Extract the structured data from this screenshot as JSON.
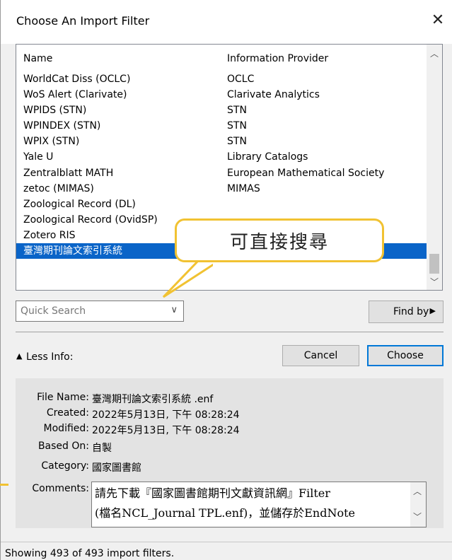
{
  "window": {
    "title": "Choose An Import Filter",
    "close_glyph": "✕"
  },
  "list": {
    "columns": [
      "Name",
      "Information Provider"
    ],
    "rows": [
      {
        "name": "WorldCat Diss (OCLC)",
        "provider": "OCLC"
      },
      {
        "name": "WoS Alert (Clarivate)",
        "provider": "Clarivate Analytics"
      },
      {
        "name": "WPIDS (STN)",
        "provider": "STN"
      },
      {
        "name": "WPINDEX (STN)",
        "provider": "STN"
      },
      {
        "name": "WPIX (STN)",
        "provider": "STN"
      },
      {
        "name": "Yale U",
        "provider": "Library Catalogs"
      },
      {
        "name": "Zentralblatt MATH",
        "provider": "European Mathematical Society"
      },
      {
        "name": "zetoc (MIMAS)",
        "provider": "MIMAS"
      },
      {
        "name": "Zoological Record (DL)",
        "provider": ""
      },
      {
        "name": "Zoological Record (OvidSP)",
        "provider": ""
      },
      {
        "name": "Zotero RIS",
        "provider": ""
      },
      {
        "name": "臺灣期刊論文索引系統",
        "provider": "國家圖書館",
        "selected": true
      }
    ],
    "selected_color": "#0a64c8"
  },
  "callout": {
    "text": "可直接搜尋",
    "border_color": "#f1c232"
  },
  "quick_search": {
    "placeholder": "Quick Search"
  },
  "findby": {
    "label": "Find by"
  },
  "less_info": {
    "label": "Less Info:"
  },
  "buttons": {
    "cancel": "Cancel",
    "choose": "Choose"
  },
  "info": {
    "file_name_label": "File Name:",
    "file_name": "臺灣期刊論文索引系統 .enf",
    "created_label": "Created:",
    "created": "2022年5月13日, 下午 08:28:24",
    "modified_label": "Modified:",
    "modified": "2022年5月13日, 下午 08:28:24",
    "based_on_label": "Based On:",
    "based_on": "自製",
    "category_label": "Category:",
    "category": "國家圖書館",
    "comments_label": "Comments:",
    "comments": "請先下載『國家圖書館期刊文獻資訊網』Filter\n(檔名NCL_Journal TPL.enf)，並儲存於EndNote"
  },
  "status": {
    "text": "Showing 493 of 493 import filters."
  }
}
